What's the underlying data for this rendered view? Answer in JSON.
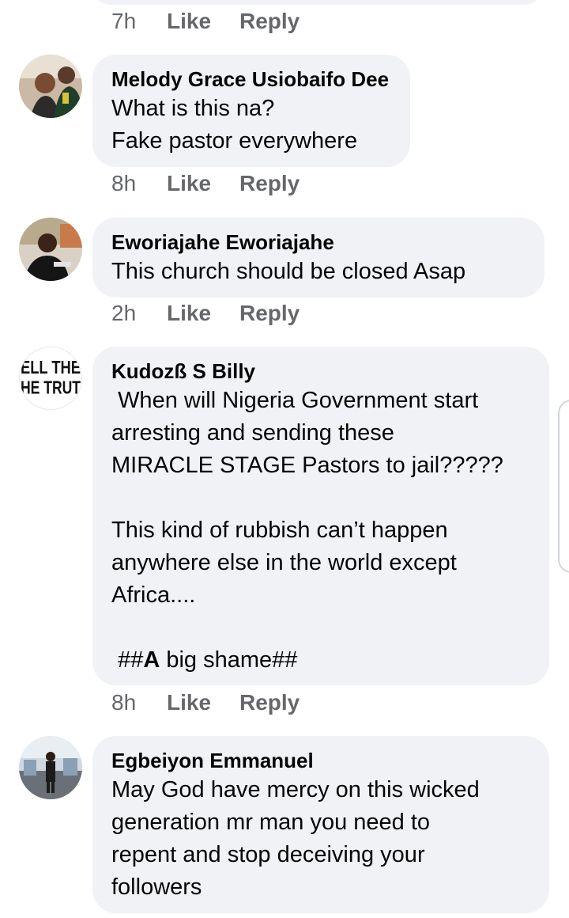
{
  "prev_meta": {
    "time": "7h",
    "like": "Like",
    "reply": "Reply"
  },
  "comments": [
    {
      "author": "Melody Grace Usiobaifo Dee",
      "lines": [
        "What is this na?",
        "Fake pastor everywhere"
      ],
      "time": "8h",
      "like": "Like",
      "reply": "Reply"
    },
    {
      "author": "Eworiajahe Eworiajahe",
      "lines": [
        "This church should be closed Asap"
      ],
      "time": "2h",
      "like": "Like",
      "reply": "Reply"
    },
    {
      "author": "Kudozß S Billy",
      "avatar_text": [
        "ELL THE",
        "HE TRUT"
      ],
      "lines": [
        " When will Nigeria Government start",
        "arresting and sending these",
        "MIRACLE STAGE Pastors to jail?????",
        "",
        "This kind of rubbish can’t happen",
        "anywhere else in the world except",
        "Africa....",
        ""
      ],
      "last_line": {
        "lead": " ##",
        "bold": "A",
        "rest": " big shame##"
      },
      "time": "8h",
      "like": "Like",
      "reply": "Reply"
    },
    {
      "author": "Egbeiyon Emmanuel",
      "lines": [
        "May God have mercy on this wicked",
        "generation mr man you need to",
        "repent and stop deceiving your",
        "followers"
      ]
    }
  ],
  "colors": {
    "bubble": "#f0f2f5",
    "meta": "#65676b",
    "text": "#050505"
  }
}
